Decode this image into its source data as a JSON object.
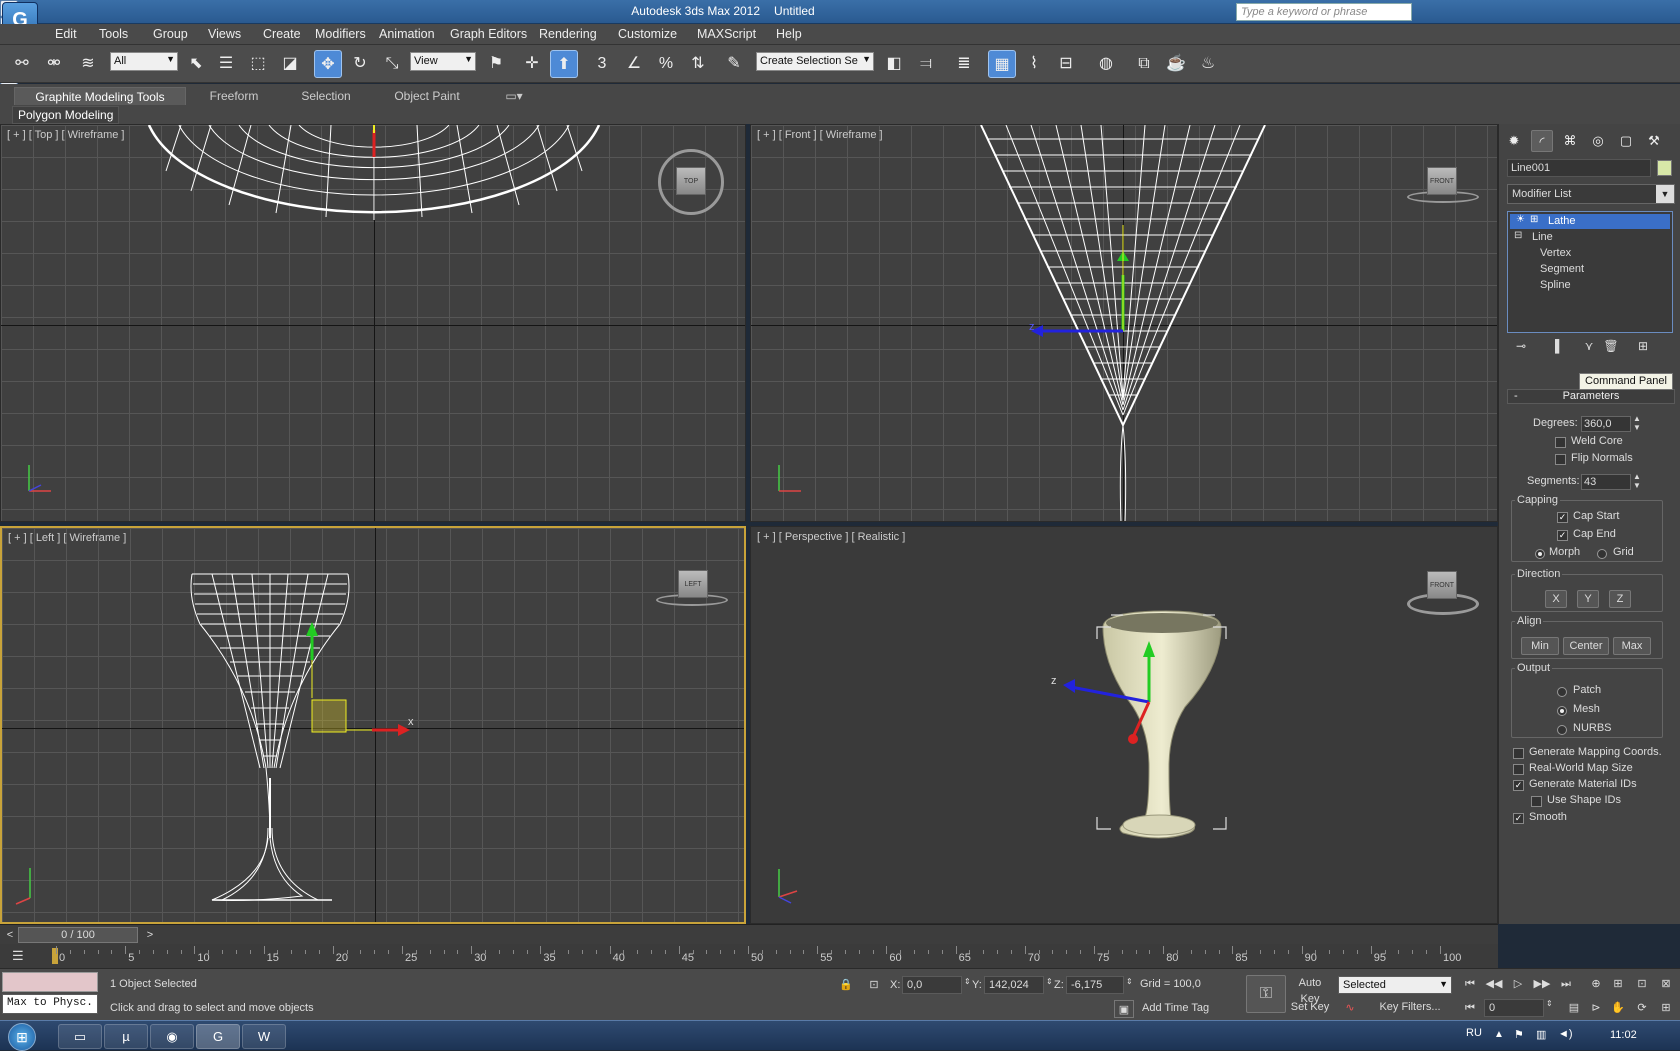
{
  "window": {
    "app": "Autodesk 3ds Max  2012",
    "doc": "Untitled",
    "search_placeholder": "Type a keyword or phrase"
  },
  "menus": [
    "Edit",
    "Tools",
    "Group",
    "Views",
    "Create",
    "Modifiers",
    "Animation",
    "Graph Editors",
    "Rendering",
    "Customize",
    "MAXScript",
    "Help"
  ],
  "toolbar": {
    "filter": "All",
    "ref_coord": "View",
    "selection_set": "Create Selection Se",
    "snap_3": "3",
    "snap_percent": "%"
  },
  "ribbon": {
    "tabs": [
      "Graphite Modeling Tools",
      "Freeform",
      "Selection",
      "Object Paint"
    ],
    "panel": "Polygon Modeling"
  },
  "viewports": {
    "top": {
      "label": "[ + ] [ Top ] [ Wireframe ]",
      "cube": "TOP"
    },
    "front": {
      "label": "[ + ] [ Front ] [ Wireframe ]",
      "cube": "FRONT",
      "axis_z": "z"
    },
    "left": {
      "label": "[ + ] [ Left ] [ Wireframe ]",
      "cube": "LEFT",
      "axis_x": "x"
    },
    "persp": {
      "label": "[ + ] [ Perspective ] [ Realistic ]",
      "cube": "FRONT",
      "axis_z": "z"
    }
  },
  "axes": {
    "x": "x",
    "y": "y",
    "z": "z"
  },
  "command_panel": {
    "object_name": "Line001",
    "modifier_list": "Modifier List",
    "stack": [
      "Lathe",
      "Line",
      "Vertex",
      "Segment",
      "Spline"
    ],
    "tooltip": "Command Panel",
    "rollout": "Parameters",
    "degrees_label": "Degrees:",
    "degrees": "360,0",
    "weld_core": "Weld Core",
    "flip_normals": "Flip Normals",
    "segments_label": "Segments:",
    "segments": "43",
    "capping": "Capping",
    "cap_start": "Cap Start",
    "cap_end": "Cap End",
    "morph": "Morph",
    "grid": "Grid",
    "direction": "Direction",
    "dir_x": "X",
    "dir_y": "Y",
    "dir_z": "Z",
    "align": "Align",
    "align_min": "Min",
    "align_center": "Center",
    "align_max": "Max",
    "output": "Output",
    "patch": "Patch",
    "mesh": "Mesh",
    "nurbs": "NURBS",
    "gen_mapping": "Generate Mapping Coords.",
    "real_world": "Real-World Map Size",
    "gen_mat_ids": "Generate Material IDs",
    "use_shape_ids": "Use Shape IDs",
    "smooth": "Smooth"
  },
  "timeline": {
    "frame": "0 / 100",
    "prev": "<",
    "next": ">",
    "ticks": [
      "0",
      "5",
      "10",
      "15",
      "20",
      "25",
      "30",
      "35",
      "40",
      "45",
      "50",
      "55",
      "60",
      "65",
      "70",
      "75",
      "80",
      "85",
      "90",
      "95",
      "100"
    ]
  },
  "status": {
    "listener": "Max to Physc.",
    "selected": "1 Object Selected",
    "prompt": "Click and drag to select and move objects",
    "x_label": "X:",
    "x": "0,0",
    "y_label": "Y:",
    "y": "142,024",
    "z_label": "Z:",
    "z": "-6,175",
    "grid": "Grid = 100,0",
    "add_time_tag": "Add Time Tag",
    "auto_key": "Auto Key",
    "set_key": "Set Key",
    "key_mode": "Selected",
    "key_filters": "Key Filters...",
    "frame_field": "0"
  },
  "taskbar": {
    "lang": "RU",
    "time": "11:02"
  }
}
